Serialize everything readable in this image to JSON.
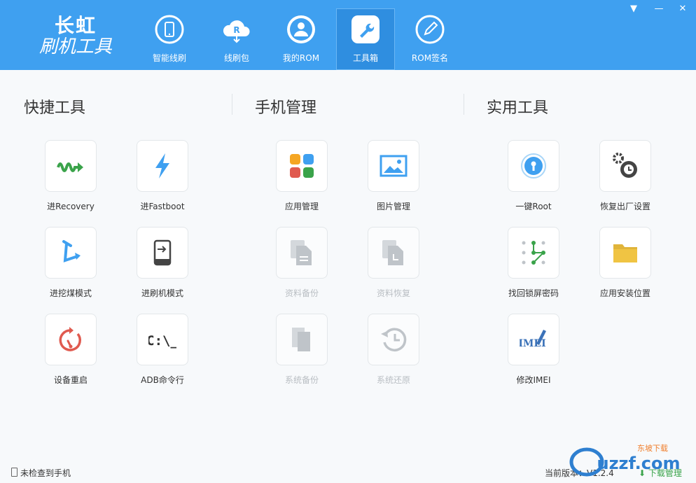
{
  "app": {
    "logo_line1": "长虹",
    "logo_line2": "刷机工具"
  },
  "window_controls": {
    "menu": "▼",
    "minimize": "—",
    "close": "✕"
  },
  "nav": [
    {
      "label": "智能线刷",
      "icon": "phone-refresh-icon"
    },
    {
      "label": "线刷包",
      "icon": "cloud-download-icon"
    },
    {
      "label": "我的ROM",
      "icon": "user-icon"
    },
    {
      "label": "工具箱",
      "icon": "wrench-icon",
      "active": true
    },
    {
      "label": "ROM签名",
      "icon": "pen-icon"
    }
  ],
  "sections": {
    "quick": {
      "title": "快捷工具"
    },
    "phone": {
      "title": "手机管理"
    },
    "util": {
      "title": "实用工具"
    }
  },
  "tools": {
    "recovery": "进Recovery",
    "fastboot": "进Fastboot",
    "wajue": "进挖煤模式",
    "flash_mode": "进刷机模式",
    "reboot": "设备重启",
    "adb": "ADB命令行",
    "app_mgmt": "应用管理",
    "photo_mgmt": "图片管理",
    "data_backup": "资料备份",
    "data_restore": "资料恢复",
    "sys_backup": "系统备份",
    "sys_restore": "系统还原",
    "root": "一键Root",
    "factory_reset": "恢复出厂设置",
    "unlock_pwd": "找回锁屏密码",
    "install_loc": "应用安装位置",
    "imei": "修改IMEI"
  },
  "adb_glyph": "C:\\_",
  "imei_glyph": "IMEI",
  "footer": {
    "status": "未检查到手机",
    "version": "当前版本：V1.2.4",
    "download": "下载管理"
  },
  "watermark": {
    "text": "uzzf.com",
    "sub": "东坡下载"
  },
  "colors": {
    "header": "#3fa0f0",
    "accent_green": "#3aa34a"
  }
}
